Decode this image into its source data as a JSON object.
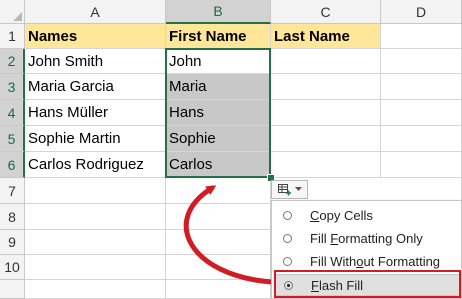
{
  "columns": [
    "A",
    "B",
    "C",
    "D"
  ],
  "rows": [
    "1",
    "2",
    "3",
    "4",
    "5",
    "6",
    "7",
    "8",
    "9",
    "10"
  ],
  "headers": {
    "a": "Names",
    "b": "First Name",
    "c": "Last Name"
  },
  "data": [
    {
      "name": "John Smith",
      "first": "John"
    },
    {
      "name": "Maria Garcia",
      "first": "Maria"
    },
    {
      "name": "Hans Müller",
      "first": "Hans"
    },
    {
      "name": "Sophie Martin",
      "first": "Sophie"
    },
    {
      "name": "Carlos Rodriguez",
      "first": "Carlos"
    }
  ],
  "autofill_menu": {
    "items": [
      {
        "label": "Copy Cells",
        "accel": "C",
        "rest": "opy Cells",
        "selected": false
      },
      {
        "label": "Fill Formatting Only",
        "pre": "Fill ",
        "accel": "F",
        "rest": "ormatting Only",
        "selected": false
      },
      {
        "label": "Fill Without Formatting",
        "pre": "Fill With",
        "accel": "o",
        "rest": "ut Formatting",
        "selected": false
      },
      {
        "label": "Flash Fill",
        "accel": "F",
        "rest": "lash Fill",
        "selected": true
      }
    ]
  },
  "colors": {
    "header_fill": "#ffe699",
    "flash_fill": "#c8c8c8",
    "selection_border": "#217346",
    "annotation_red": "#d11c24"
  },
  "icons": {
    "auto_fill_options": "auto-fill-options-icon",
    "arrow": "curved-arrow"
  }
}
